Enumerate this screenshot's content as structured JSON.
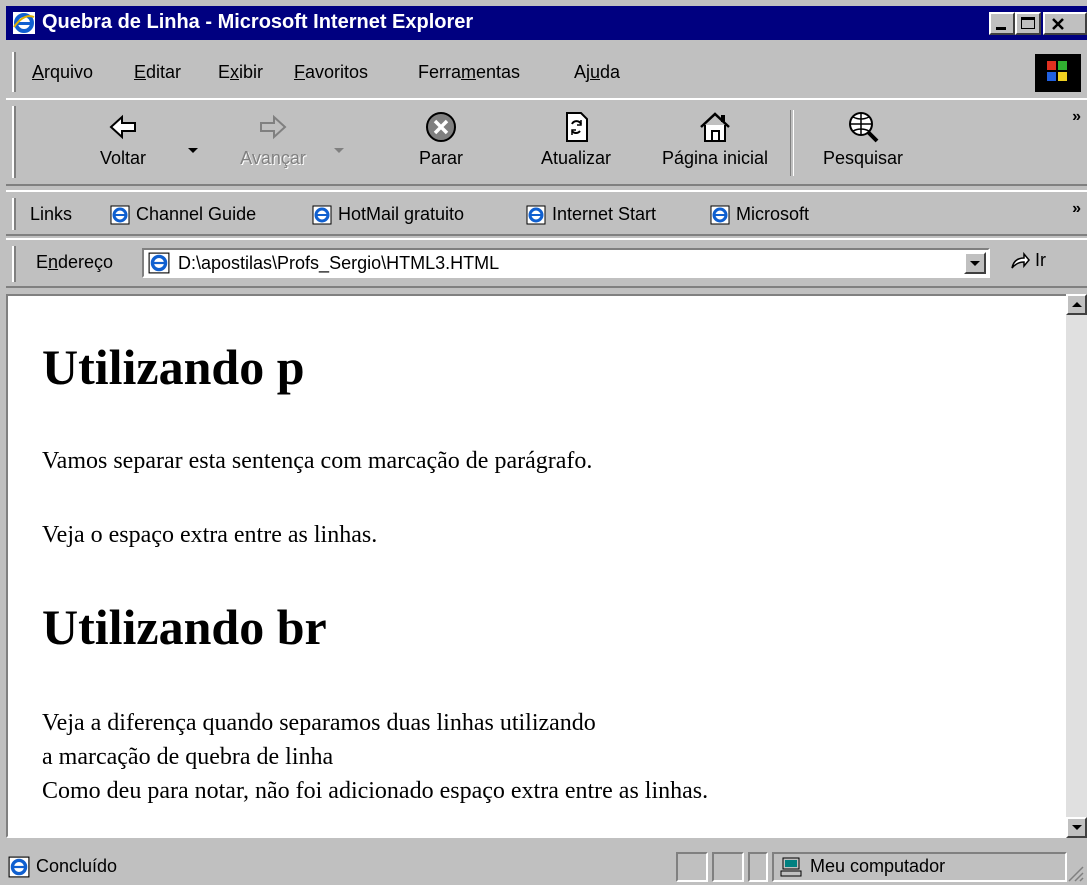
{
  "window": {
    "title": "Quebra de Linha - Microsoft Internet Explorer"
  },
  "menu": {
    "items": [
      {
        "label": "Arquivo",
        "accel": "A"
      },
      {
        "label": "Editar",
        "accel": "E"
      },
      {
        "label": "Exibir",
        "accel": "x"
      },
      {
        "label": "Favoritos",
        "accel": "F"
      },
      {
        "label": "Ferramentas",
        "accel": "m"
      },
      {
        "label": "Ajuda",
        "accel": "u"
      }
    ]
  },
  "toolbar": {
    "back_label": "Voltar",
    "forward_label": "Avançar",
    "stop_label": "Parar",
    "refresh_label": "Atualizar",
    "home_label": "Página inicial",
    "search_label": "Pesquisar",
    "more": "»"
  },
  "links": {
    "label": "Links",
    "items": [
      "Channel Guide",
      "HotMail gratuito",
      "Internet Start",
      "Microsoft"
    ],
    "more": "»"
  },
  "address": {
    "label": "Endereço",
    "value": "D:\\apostilas\\Profs_Sergio\\HTML3.HTML",
    "go_label": "Ir"
  },
  "document": {
    "heading1": "Utilizando p",
    "para1": "Vamos separar esta sentença com marcação de parágrafo.",
    "para2": "Veja o espaço extra entre as linhas.",
    "heading2": "Utilizando br",
    "br_lines": [
      "Veja a diferença quando separamos duas linhas utilizando",
      "a marcação de quebra de linha",
      "Como deu para notar, não foi adicionado espaço extra entre as linhas."
    ]
  },
  "status": {
    "text": "Concluído",
    "zone": "Meu computador"
  }
}
